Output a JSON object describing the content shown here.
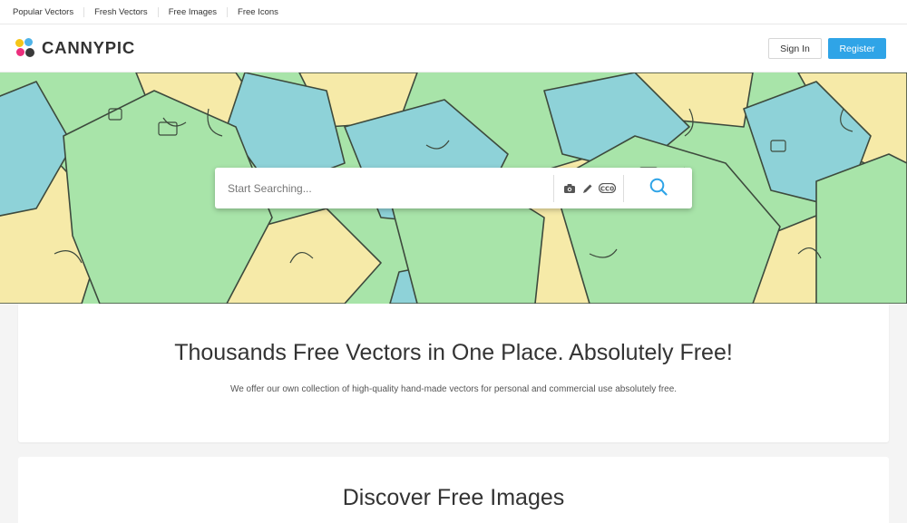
{
  "topnav": {
    "items": [
      "Popular Vectors",
      "Fresh Vectors",
      "Free Images",
      "Free Icons"
    ]
  },
  "header": {
    "logo_text": "CANNYPIC",
    "signin_label": "Sign In",
    "register_label": "Register"
  },
  "search": {
    "placeholder": "Start Searching...",
    "value": ""
  },
  "intro": {
    "title": "Thousands Free Vectors in One Place. Absolutely Free!",
    "subtitle": "We offer our own collection of high-quality hand-made vectors for personal and commercial use absolutely free."
  },
  "discover": {
    "title": "Discover Free Images"
  },
  "colors": {
    "accent": "#2fa4e7",
    "hero_green": "#a8e4a9",
    "hero_blue": "#8ed2d8",
    "hero_yellow": "#f6eaa8"
  },
  "icons": [
    "camera-icon",
    "pencil-icon",
    "cc0-icon",
    "search-icon"
  ]
}
